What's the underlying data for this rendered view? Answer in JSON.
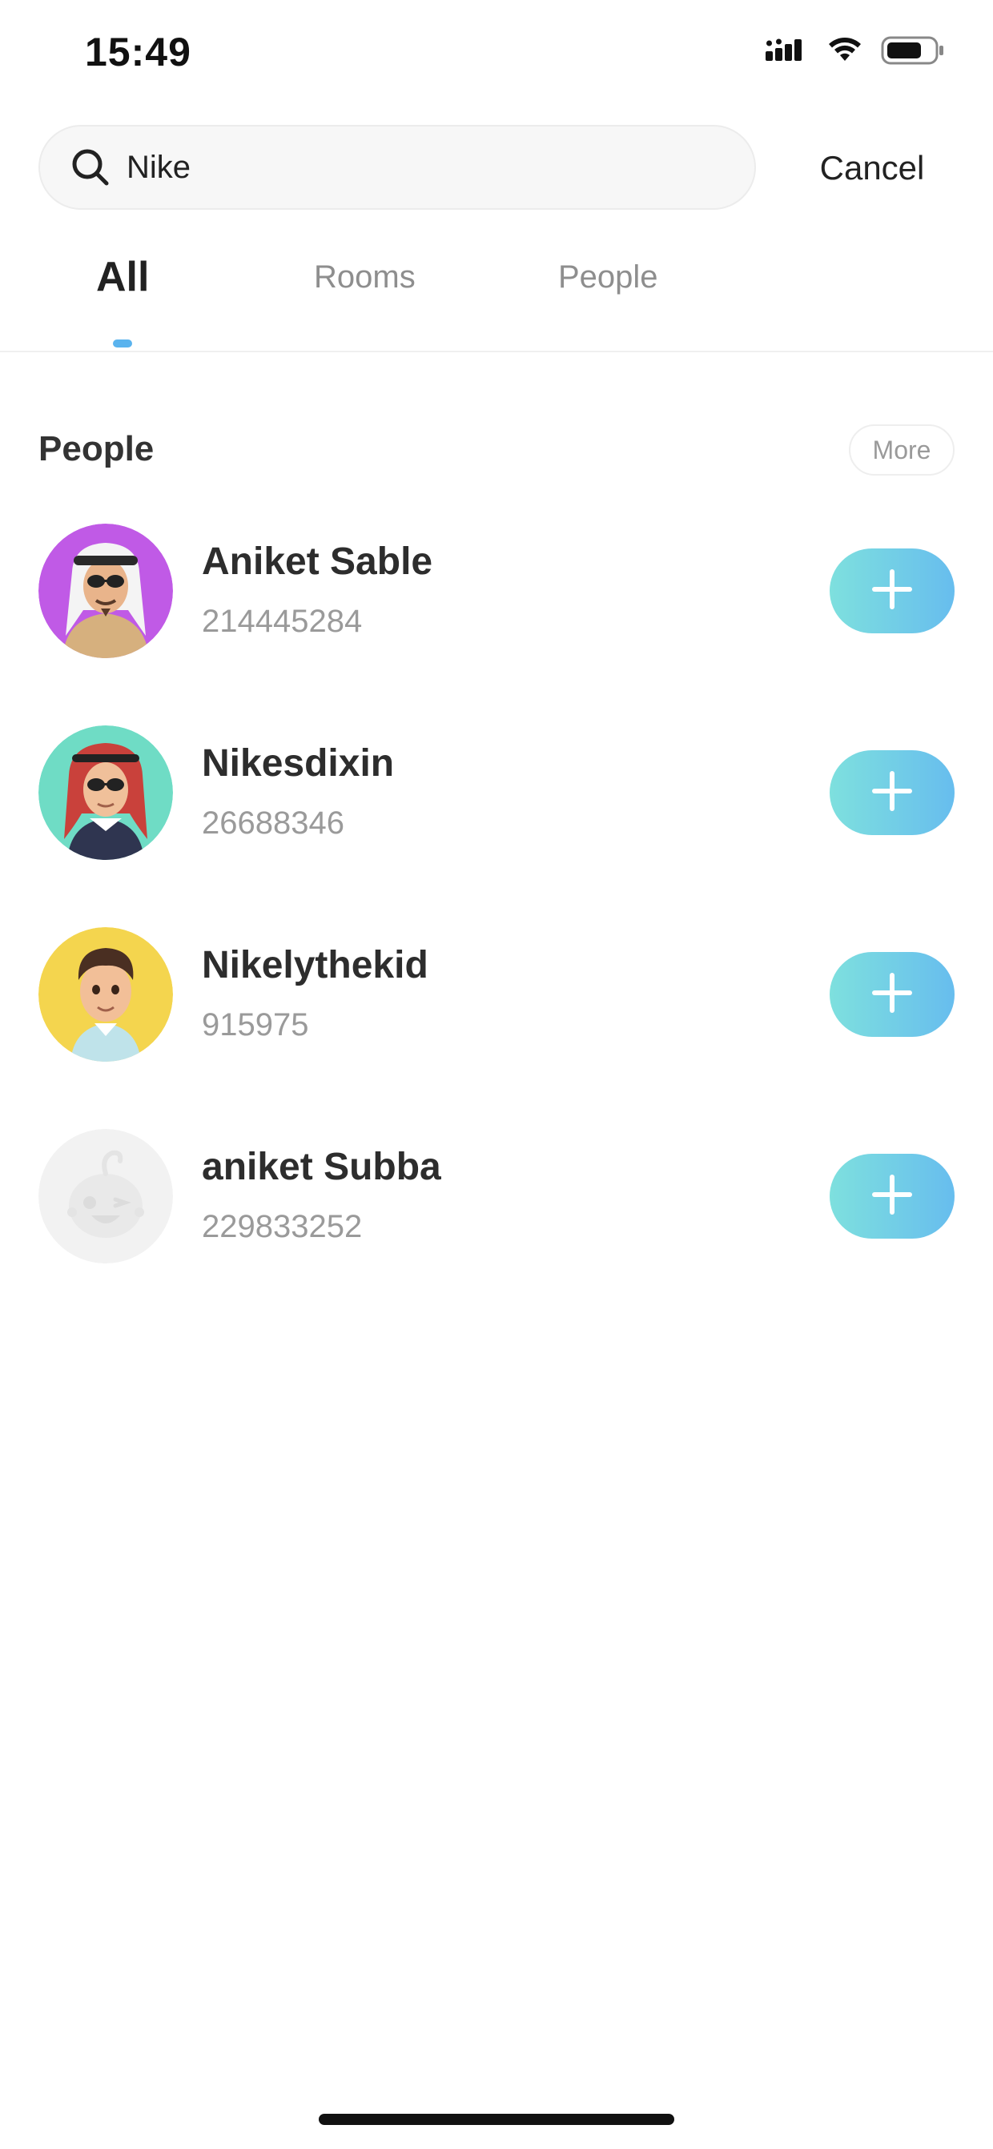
{
  "status_bar": {
    "time": "15:49",
    "icons": [
      "cellular-signal-icon",
      "wifi-icon",
      "battery-icon"
    ]
  },
  "search": {
    "value": "Nike",
    "icon": "search-icon",
    "cancel_label": "Cancel"
  },
  "tabs": [
    {
      "label": "All",
      "active": true
    },
    {
      "label": "Rooms",
      "active": false
    },
    {
      "label": "People",
      "active": false
    }
  ],
  "people_section": {
    "title": "People",
    "more_label": "More",
    "results": [
      {
        "name": "Aniket Sable",
        "id": "214445284",
        "avatar_bg": "#c05ae6",
        "add_icon": "plus-icon"
      },
      {
        "name": "Nikesdixin",
        "id": "26688346",
        "avatar_bg": "#6fdcc5",
        "add_icon": "plus-icon"
      },
      {
        "name": "Nikelythekid",
        "id": "915975",
        "avatar_bg": "#f4d54e",
        "add_icon": "plus-icon"
      },
      {
        "name": "aniket Subba",
        "id": "229833252",
        "avatar_bg": "#f2f2f2",
        "add_icon": "plus-icon"
      }
    ]
  },
  "colors": {
    "accent": "#5ab3ee",
    "add_gradient_start": "#7ee0de",
    "add_gradient_end": "#67bdee",
    "text_primary": "#2d2d2d",
    "text_secondary": "#9a9a9a"
  }
}
